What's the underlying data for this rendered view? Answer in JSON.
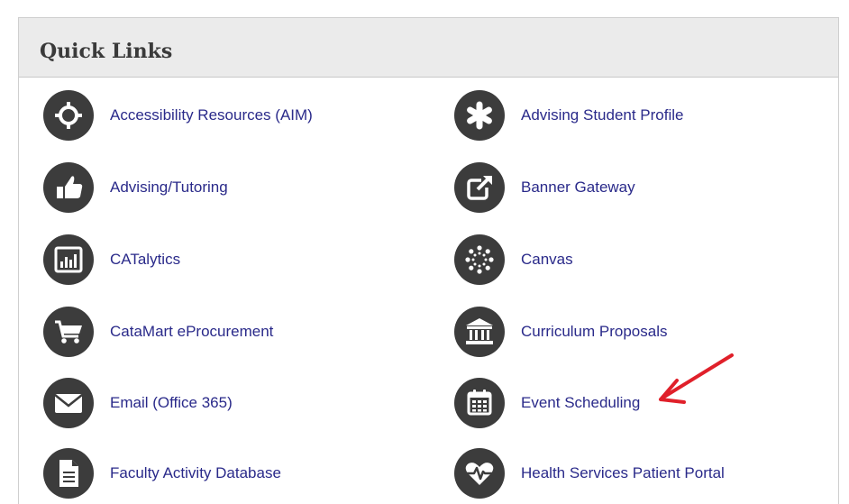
{
  "panel": {
    "title": "Quick Links"
  },
  "links": {
    "accessibility": "Accessibility Resources (AIM)",
    "advising_profile": "Advising Student Profile",
    "advising_tutoring": "Advising/Tutoring",
    "banner": "Banner Gateway",
    "catalytics": "CATalytics",
    "canvas": "Canvas",
    "catamart": "CataMart eProcurement",
    "curriculum": "Curriculum Proposals",
    "email": "Email (Office 365)",
    "event": "Event Scheduling",
    "faculty": "Faculty Activity Database",
    "health": "Health Services Patient Portal"
  },
  "icons": {
    "accessibility": "crosshair-icon",
    "advising_profile": "asterisk-icon",
    "advising_tutoring": "thumbs-up-icon",
    "banner": "external-link-icon",
    "catalytics": "bar-chart-icon",
    "canvas": "dotted-circle-icon",
    "catamart": "shopping-cart-icon",
    "curriculum": "institution-icon",
    "email": "envelope-icon",
    "event": "calendar-icon",
    "faculty": "document-icon",
    "health": "heartbeat-icon"
  },
  "colors": {
    "icon_bg": "#3c3c3c",
    "link_text": "#2a2a8a",
    "header_bg": "#ebebeb",
    "annotation": "#e0202a"
  }
}
